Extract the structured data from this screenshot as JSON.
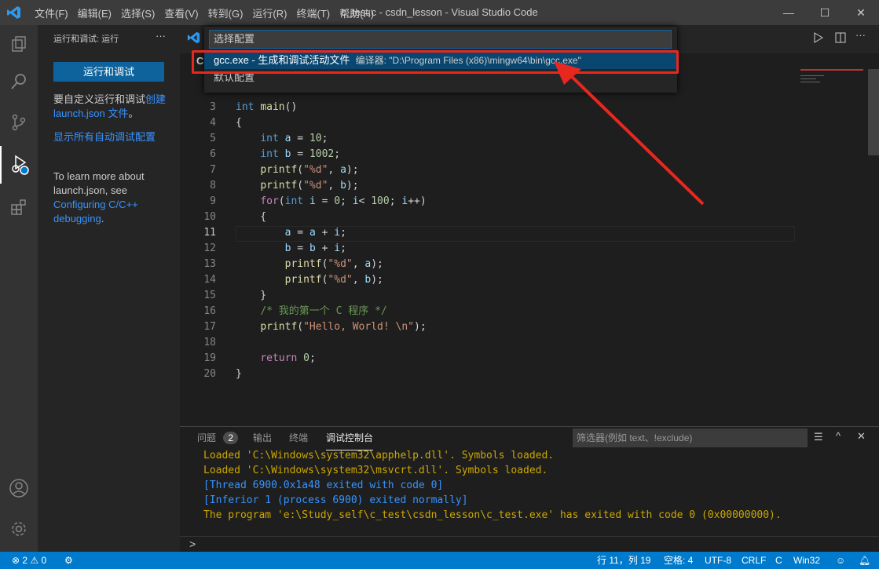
{
  "titlebar": {
    "menus": [
      "文件(F)",
      "编辑(E)",
      "选择(S)",
      "查看(V)",
      "转到(G)",
      "运行(R)",
      "终端(T)",
      "帮助(H)"
    ],
    "title": "c_test.c - csdn_lesson - Visual Studio Code"
  },
  "sidebar": {
    "header": "运行和调试: 运行",
    "more": "···",
    "run_button": "运行和调试",
    "text1": "要自定义运行和调试",
    "link1": "创建 launch.json 文件",
    "text1b": "。",
    "link2": "显示所有自动调试配置",
    "text3": "To learn more about launch.json, see ",
    "link3": "Configuring C/C++ debugging",
    "text3b": "."
  },
  "quickpick": {
    "placeholder": "选择配置",
    "items": [
      {
        "label": "gcc.exe - 生成和调试活动文件",
        "detail": "编译器: \"D:\\Program Files (x86)\\mingw64\\bin\\gcc.exe\""
      },
      {
        "label": "默认配置"
      }
    ]
  },
  "editor": {
    "tab_letter": "C",
    "lines": [
      3,
      4,
      5,
      6,
      7,
      8,
      9,
      10,
      11,
      12,
      13,
      14,
      15,
      16,
      17,
      18,
      19,
      20
    ]
  },
  "panel": {
    "tabs": [
      "问题",
      "输出",
      "终端",
      "调试控制台"
    ],
    "problems_count": "2",
    "filter_placeholder": "筛选器(例如 text、!exclude)",
    "prompt": ">",
    "output": [
      {
        "text": "Loaded 'C:\\Windows\\system32\\apphelp.dll'. Symbols loaded.",
        "color": "#cca700"
      },
      {
        "text": "Loaded 'C:\\Windows\\system32\\msvcrt.dll'. Symbols loaded.",
        "color": "#cca700"
      },
      {
        "text": "[Thread 6900.0x1a48 exited with code 0]",
        "color": "#3794ff"
      },
      {
        "text": "[Inferior 1 (process 6900) exited normally]",
        "color": "#3794ff"
      },
      {
        "text": "The program 'e:\\Study_self\\c_test\\csdn_lesson\\c_test.exe' has exited with code 0 (0x00000000).",
        "color": "#cca700"
      }
    ]
  },
  "status": {
    "errors": "2",
    "warnings": "0",
    "position": "行 11，列 19",
    "spaces": "空格: 4",
    "encoding": "UTF-8",
    "eol": "CRLF",
    "language": "C",
    "platform": "Win32"
  }
}
